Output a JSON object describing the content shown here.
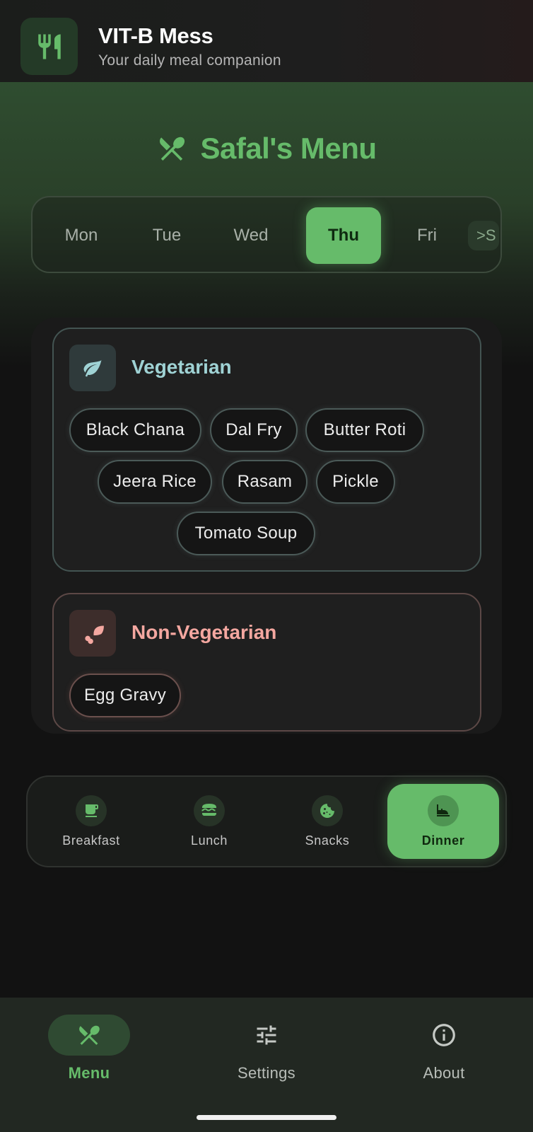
{
  "header": {
    "title": "VIT-B Mess",
    "subtitle": "Your daily meal companion",
    "logo_icon": "fork-knife-icon"
  },
  "menu_title": "Safal's Menu",
  "days": {
    "items": [
      "Mon",
      "Tue",
      "Wed",
      "Thu",
      "Fri"
    ],
    "selected": "Thu",
    "overflow_label": ">S"
  },
  "sections": {
    "veg": {
      "title": "Vegetarian",
      "icon": "leaf-icon",
      "items": [
        "Black Chana",
        "Dal Fry",
        "Butter Roti",
        "Jeera Rice",
        "Rasam",
        "Pickle",
        "Tomato Soup"
      ]
    },
    "nonveg": {
      "title": "Non-Vegetarian",
      "icon": "drumstick-icon",
      "items": [
        "Egg Gravy"
      ]
    }
  },
  "meals": {
    "items": [
      {
        "label": "Breakfast",
        "icon": "coffee-cup-icon"
      },
      {
        "label": "Lunch",
        "icon": "burger-icon"
      },
      {
        "label": "Snacks",
        "icon": "cookie-icon"
      },
      {
        "label": "Dinner",
        "icon": "dinner-table-icon"
      }
    ],
    "selected": "Dinner"
  },
  "nav": {
    "items": [
      {
        "label": "Menu",
        "icon": "utensils-icon"
      },
      {
        "label": "Settings",
        "icon": "sliders-icon"
      },
      {
        "label": "About",
        "icon": "info-icon"
      }
    ],
    "selected": "Menu"
  },
  "colors": {
    "accent": "#66bb6a",
    "veg_title": "#9fd2d4",
    "nonveg_title": "#f4a7a0",
    "background": "#121212"
  }
}
